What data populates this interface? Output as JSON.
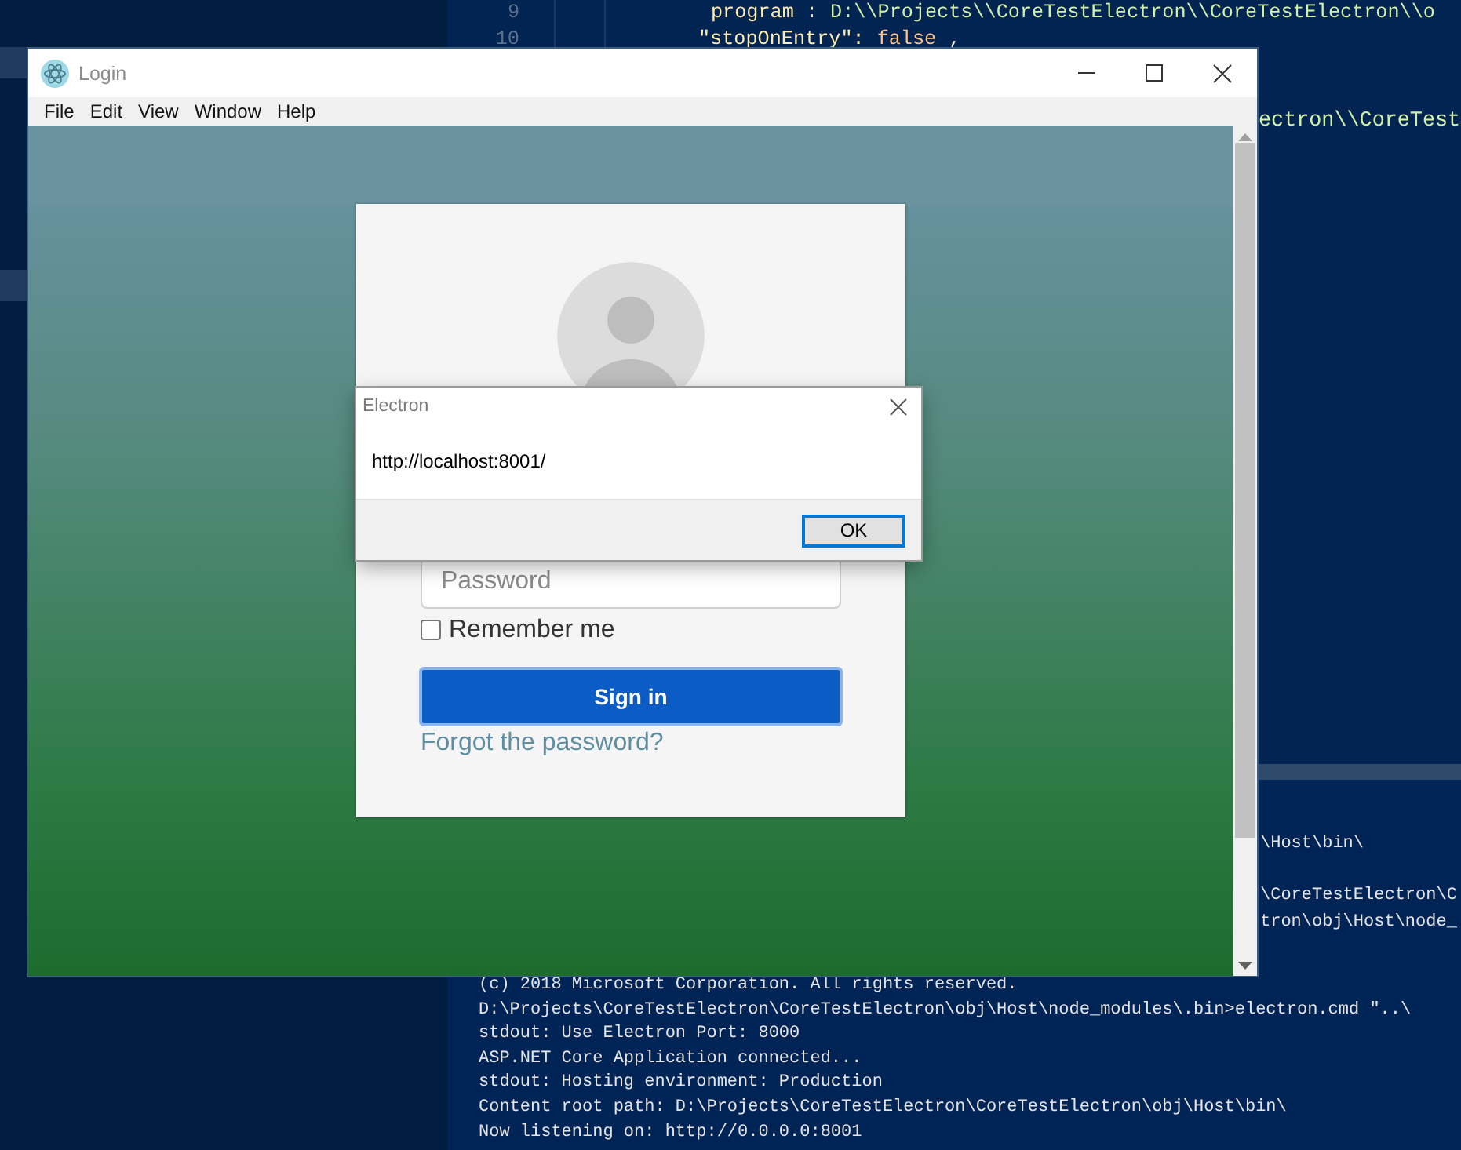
{
  "editor": {
    "lines": [
      {
        "number": "9",
        "parts": [
          {
            "kind": "key",
            "text": "program :"
          },
          {
            "kind": "string",
            "text": "D:\\\\Projects\\\\CoreTestElectron\\\\CoreTestElectron\\\\o"
          }
        ]
      },
      {
        "number": "10",
        "parts": [
          {
            "kind": "key",
            "text": "\"stopOnEntry\":"
          },
          {
            "kind": "keyword",
            "text": "false"
          },
          {
            "kind": "punct",
            "text": ","
          }
        ]
      }
    ],
    "fragments": [
      {
        "kind": "string",
        "text": "ectron\\\\CoreTest"
      }
    ]
  },
  "terminal": {
    "fragments": [
      "\\Host\\bin\\",
      "\\CoreTestElectron\\C",
      "tron\\obj\\Host\\node_"
    ],
    "lines": [
      "(c) 2018 Microsoft Corporation. All rights reserved.",
      "D:\\Projects\\CoreTestElectron\\CoreTestElectron\\obj\\Host\\node_modules\\.bin>electron.cmd \"..\\",
      "stdout: Use Electron Port: 8000",
      "ASP.NET Core Application connected...",
      "stdout: Hosting environment: Production",
      "Content root path: D:\\Projects\\CoreTestElectron\\CoreTestElectron\\obj\\Host\\bin\\",
      "Now listening on: http://0.0.0.0:8001"
    ]
  },
  "window": {
    "title": "Login",
    "menu": [
      "File",
      "Edit",
      "View",
      "Window",
      "Help"
    ]
  },
  "login": {
    "password": {
      "placeholder": "Password"
    },
    "remember": {
      "label": "Remember me",
      "checked": false
    },
    "sign_in": "Sign in",
    "forgot": "Forgot the password?"
  },
  "dialog": {
    "title": "Electron",
    "message": "http://localhost:8001/",
    "buttons": [
      "OK"
    ]
  }
}
